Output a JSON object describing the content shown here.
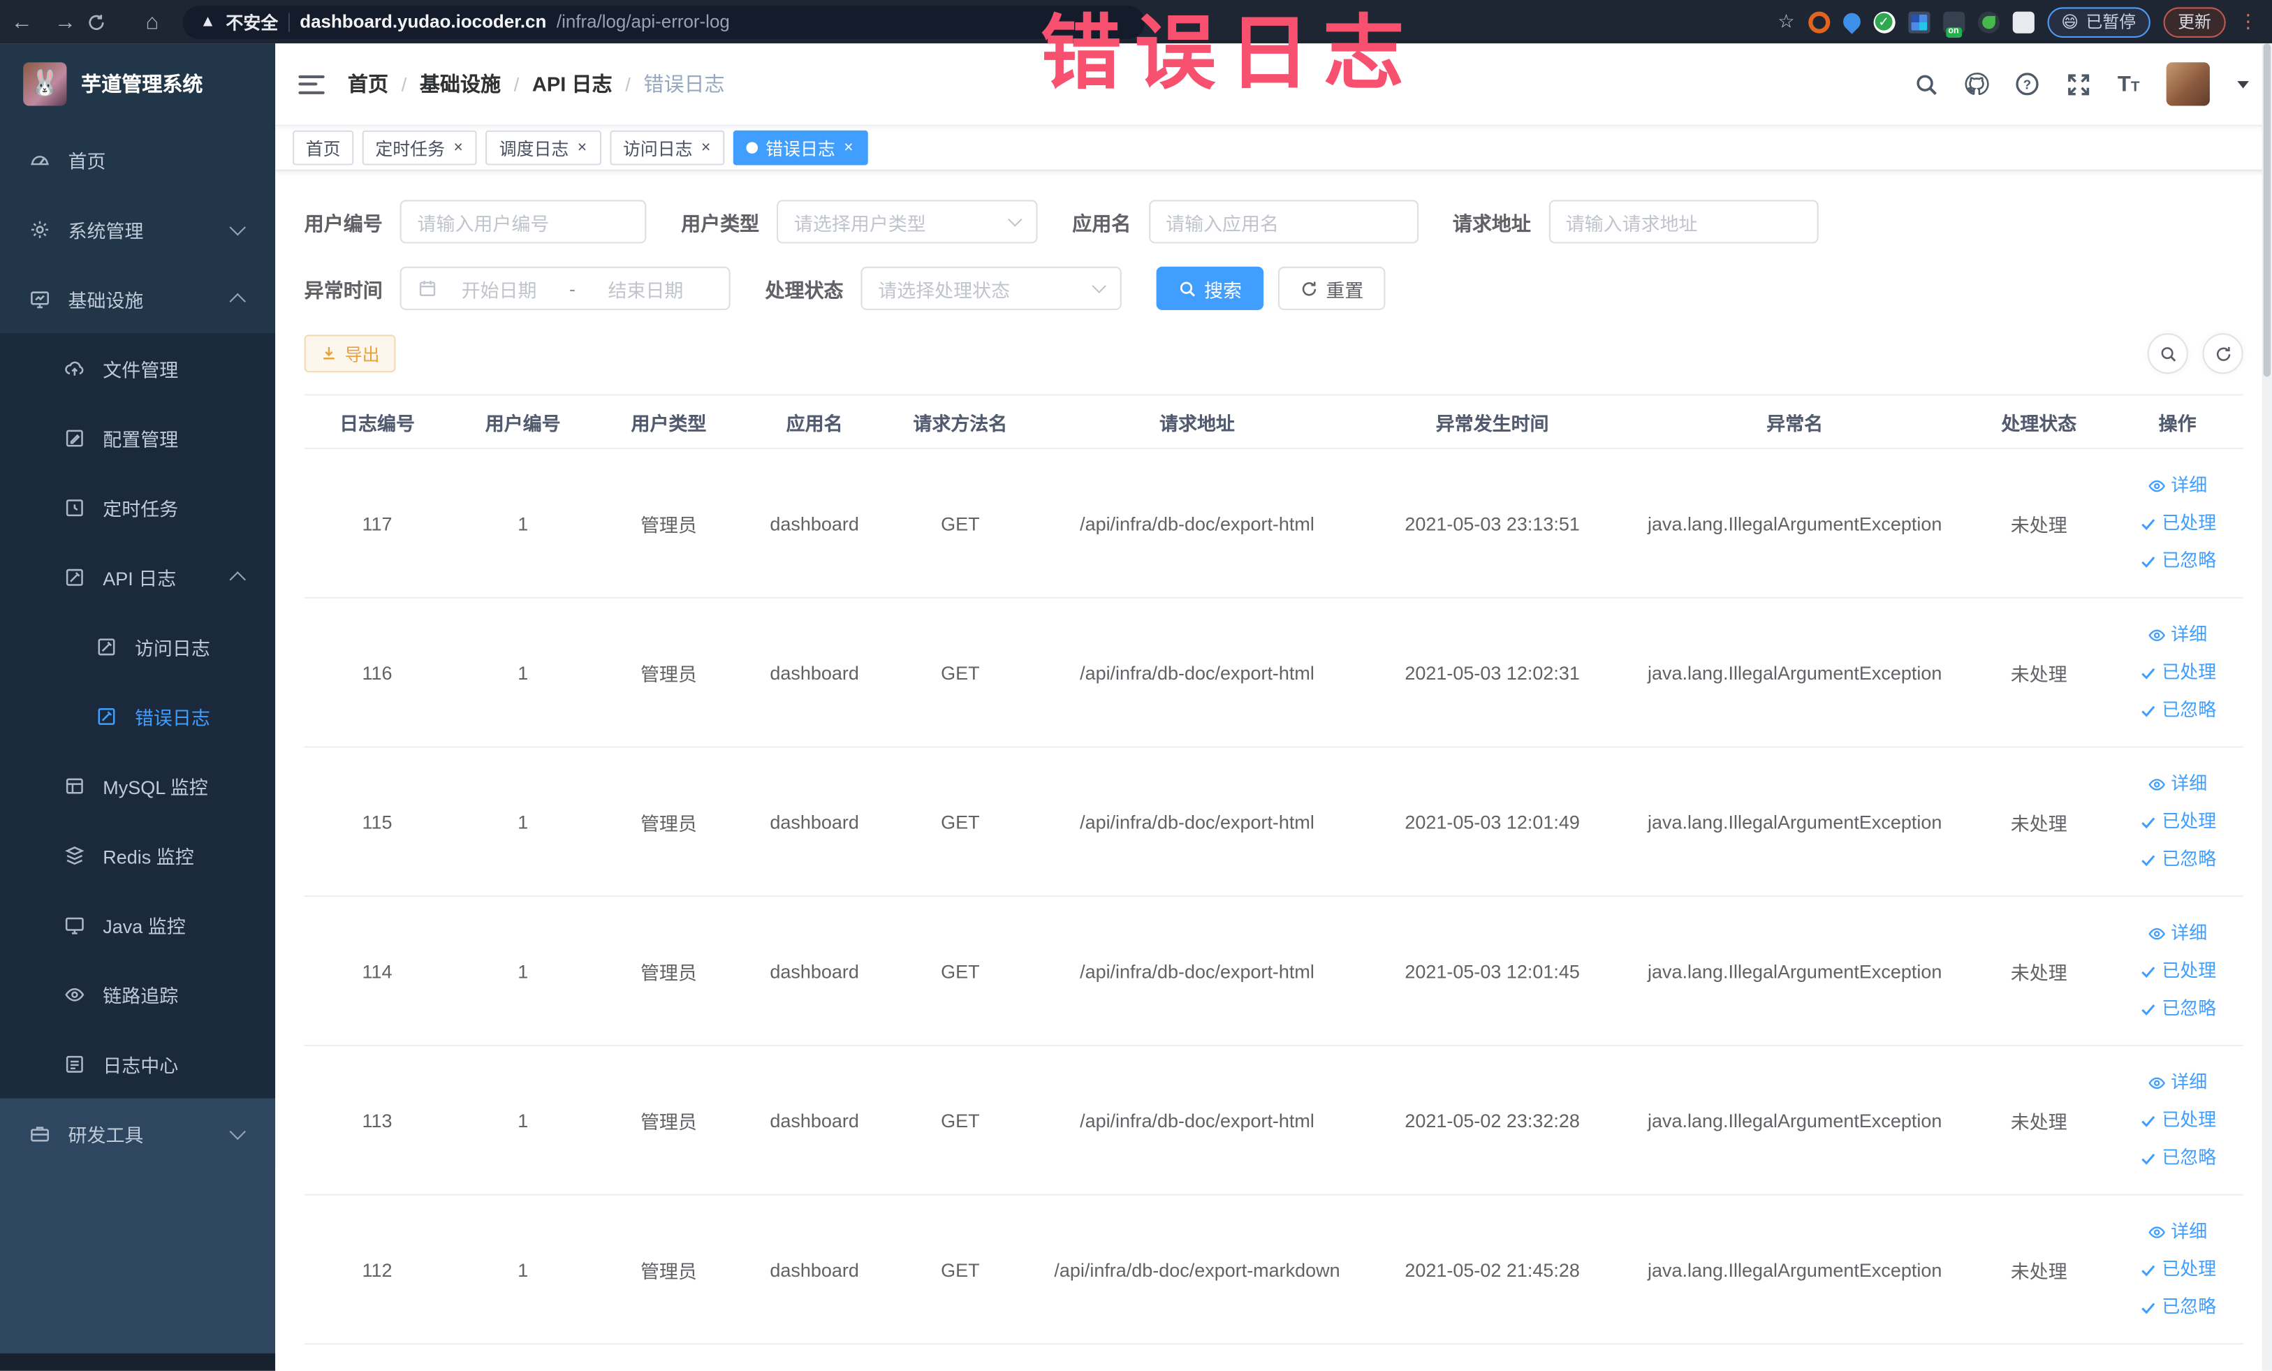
{
  "colors": {
    "accent": "#409EFF",
    "warning": "#E6A23C",
    "overlay_red": "#F8506F"
  },
  "browser": {
    "security_label": "不安全",
    "url_domain": "dashboard.yudao.iocoder.cn",
    "url_path": "/infra/log/api-error-log",
    "paused_badge": "已暂停",
    "update_button": "更新"
  },
  "overlay_annotation": "错误日志",
  "sidebar": {
    "app_title": "芋道管理系统",
    "menu": [
      {
        "label": "首页",
        "icon": "dashboard-icon"
      },
      {
        "label": "系统管理",
        "icon": "gear-icon",
        "expandable": true,
        "expanded": false
      },
      {
        "label": "基础设施",
        "icon": "infra-icon",
        "expandable": true,
        "expanded": true,
        "children": [
          {
            "label": "文件管理",
            "icon": "file-upload-icon"
          },
          {
            "label": "配置管理",
            "icon": "config-edit-icon"
          },
          {
            "label": "定时任务",
            "icon": "timer-icon"
          },
          {
            "label": "API 日志",
            "icon": "api-log-icon",
            "expandable": true,
            "expanded": true,
            "children": [
              {
                "label": "访问日志",
                "icon": "access-log-icon"
              },
              {
                "label": "错误日志",
                "icon": "error-log-icon",
                "active": true
              }
            ]
          },
          {
            "label": "MySQL 监控",
            "icon": "mysql-icon"
          },
          {
            "label": "Redis 监控",
            "icon": "redis-icon"
          },
          {
            "label": "Java 监控",
            "icon": "java-icon"
          },
          {
            "label": "链路追踪",
            "icon": "trace-eye-icon"
          },
          {
            "label": "日志中心",
            "icon": "log-center-icon"
          }
        ]
      },
      {
        "label": "研发工具",
        "icon": "devtools-icon",
        "expandable": true,
        "expanded": false,
        "tone": "light"
      }
    ]
  },
  "header": {
    "breadcrumb": [
      "首页",
      "基础设施",
      "API 日志",
      "错误日志"
    ]
  },
  "tabs": [
    {
      "label": "首页",
      "closable": false,
      "active": false
    },
    {
      "label": "定时任务",
      "closable": true,
      "active": false
    },
    {
      "label": "调度日志",
      "closable": true,
      "active": false
    },
    {
      "label": "访问日志",
      "closable": true,
      "active": false
    },
    {
      "label": "错误日志",
      "closable": true,
      "active": true
    }
  ],
  "filters": {
    "fields": [
      {
        "label": "用户编号",
        "type": "input",
        "placeholder": "请输入用户编号"
      },
      {
        "label": "用户类型",
        "type": "select",
        "placeholder": "请选择用户类型"
      },
      {
        "label": "应用名",
        "type": "input",
        "placeholder": "请输入应用名"
      },
      {
        "label": "请求地址",
        "type": "input",
        "placeholder": "请输入请求地址"
      },
      {
        "label": "异常时间",
        "type": "daterange",
        "start_placeholder": "开始日期",
        "end_placeholder": "结束日期",
        "separator": "-"
      },
      {
        "label": "处理状态",
        "type": "select",
        "placeholder": "请选择处理状态"
      }
    ],
    "search_button": "搜索",
    "reset_button": "重置"
  },
  "toolbar": {
    "export_button": "导出"
  },
  "table": {
    "columns": [
      "日志编号",
      "用户编号",
      "用户类型",
      "应用名",
      "请求方法名",
      "请求地址",
      "异常发生时间",
      "异常名",
      "处理状态",
      "操作"
    ],
    "actions": [
      "详细",
      "已处理",
      "已忽略"
    ],
    "rows": [
      {
        "id": "117",
        "user_id": "1",
        "user_type": "管理员",
        "app": "dashboard",
        "method": "GET",
        "url": "/api/infra/db-doc/export-html",
        "time": "2021-05-03 23:13:51",
        "exception": "java.lang.IllegalArgumentException",
        "status": "未处理"
      },
      {
        "id": "116",
        "user_id": "1",
        "user_type": "管理员",
        "app": "dashboard",
        "method": "GET",
        "url": "/api/infra/db-doc/export-html",
        "time": "2021-05-03 12:02:31",
        "exception": "java.lang.IllegalArgumentException",
        "status": "未处理"
      },
      {
        "id": "115",
        "user_id": "1",
        "user_type": "管理员",
        "app": "dashboard",
        "method": "GET",
        "url": "/api/infra/db-doc/export-html",
        "time": "2021-05-03 12:01:49",
        "exception": "java.lang.IllegalArgumentException",
        "status": "未处理"
      },
      {
        "id": "114",
        "user_id": "1",
        "user_type": "管理员",
        "app": "dashboard",
        "method": "GET",
        "url": "/api/infra/db-doc/export-html",
        "time": "2021-05-03 12:01:45",
        "exception": "java.lang.IllegalArgumentException",
        "status": "未处理"
      },
      {
        "id": "113",
        "user_id": "1",
        "user_type": "管理员",
        "app": "dashboard",
        "method": "GET",
        "url": "/api/infra/db-doc/export-html",
        "time": "2021-05-02 23:32:28",
        "exception": "java.lang.IllegalArgumentException",
        "status": "未处理"
      },
      {
        "id": "112",
        "user_id": "1",
        "user_type": "管理员",
        "app": "dashboard",
        "method": "GET",
        "url": "/api/infra/db-doc/export-markdown",
        "time": "2021-05-02 21:45:28",
        "exception": "java.lang.IllegalArgumentException",
        "status": "未处理"
      }
    ]
  }
}
